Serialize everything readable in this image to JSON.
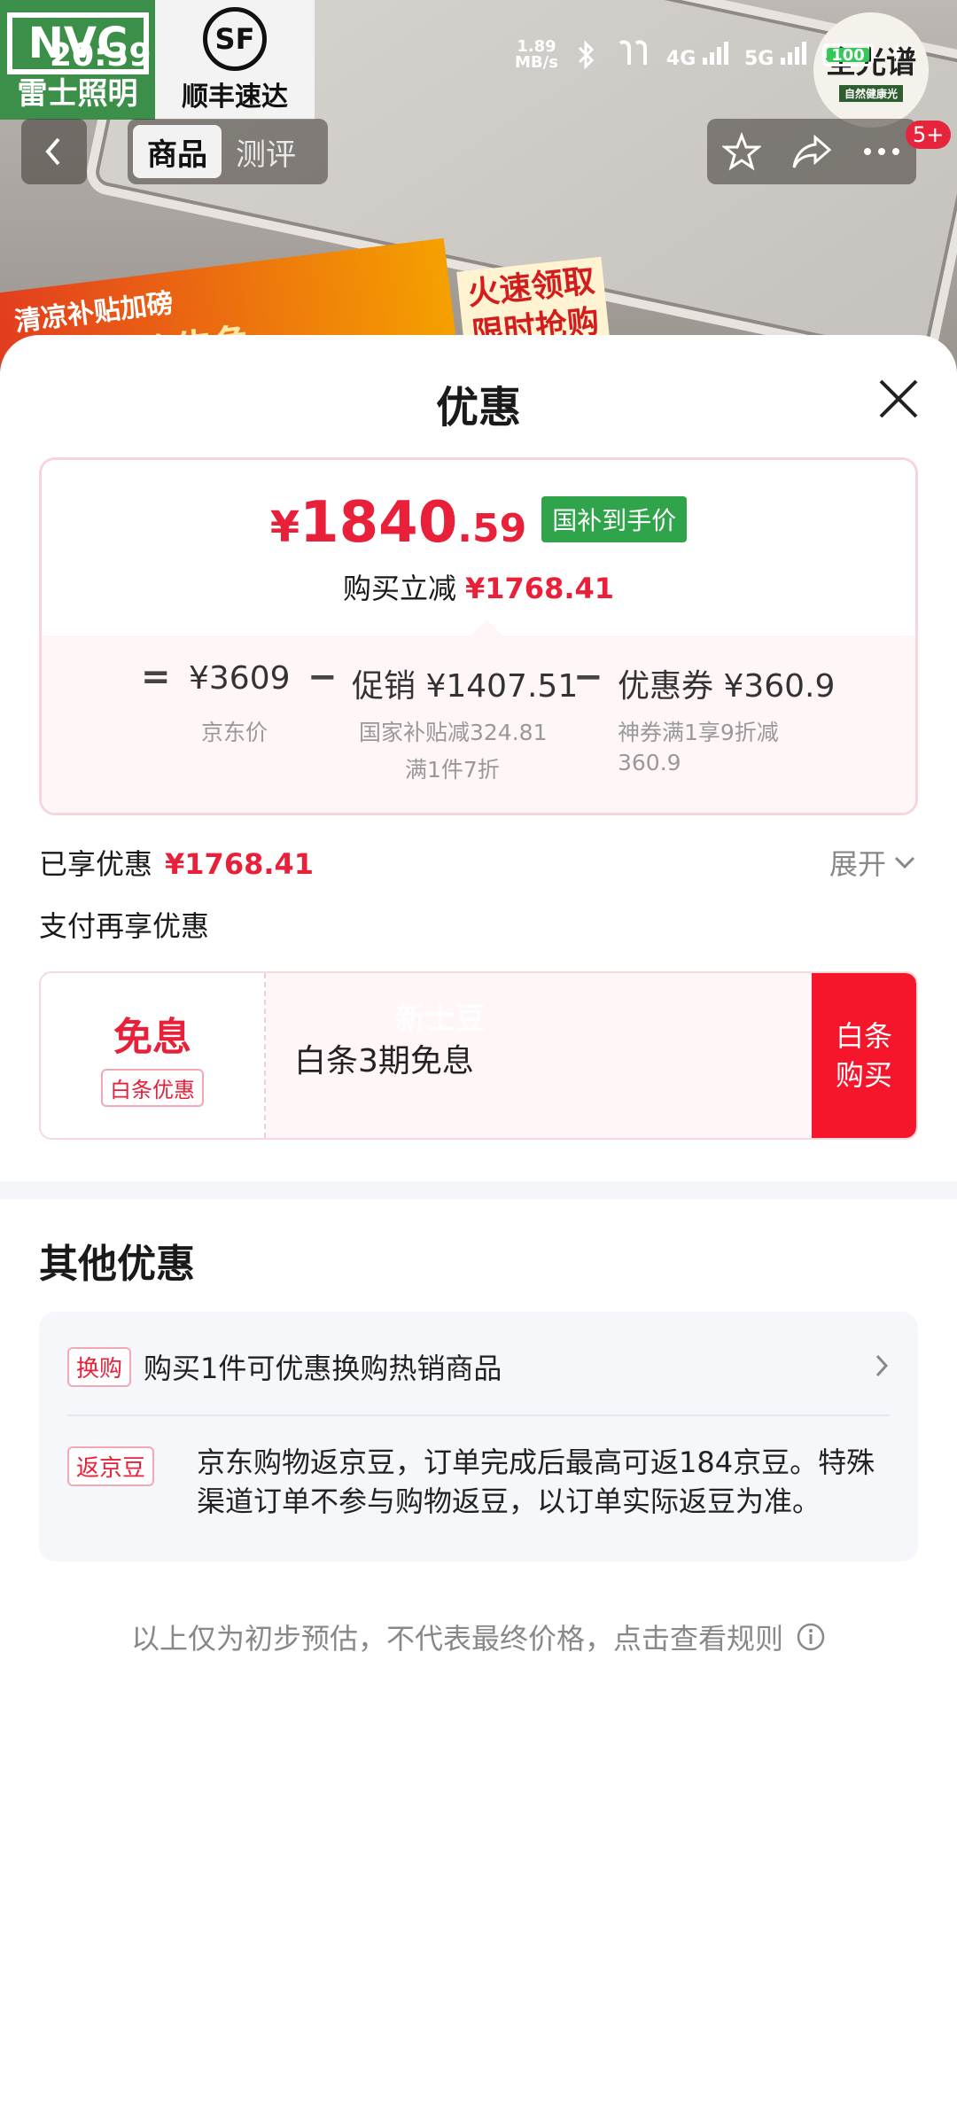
{
  "background": {
    "brand_logo": "NVC",
    "brand_name": "雷士照明",
    "sf_logo": "SF",
    "sf_name": "顺丰速达",
    "spectrum": "全光谱",
    "spectrum_small": "自然健康光",
    "promo_line1": "清凉补贴加磅",
    "promo_line2": "补贴资格告急",
    "promo_side1": "火速领取",
    "promo_side2": "限时抢购"
  },
  "status_bar": {
    "time": "20:39",
    "speed_value": "1.89",
    "speed_unit": "MB/s",
    "net1": "4G",
    "net2": "5G",
    "battery": "100"
  },
  "nav": {
    "tabs": [
      {
        "label": "商品"
      },
      {
        "label": "测评"
      }
    ],
    "badge": "5+"
  },
  "sheet": {
    "title": "优惠",
    "price": {
      "currency": "¥",
      "integer": "1840",
      "decimal": ".59",
      "tag": "国补到手价",
      "reduce_label": "购买立减",
      "reduce_amount": "¥1768.41"
    },
    "breakdown": {
      "eq": "=",
      "minus": "−",
      "jd_price": "¥3609",
      "jd_label": "京东价",
      "promo": "促销 ¥1407.51",
      "promo_sub1": "国家补贴减324.81",
      "promo_sub2": "满1件7折",
      "coupon": "优惠券 ¥360.9",
      "coupon_sub1": "神券满1享9折减",
      "coupon_sub2": "360.9"
    },
    "enjoyed_label": "已享优惠",
    "enjoyed_amount": "¥1768.41",
    "expand_label": "展开",
    "pay_more_label": "支付再享优惠",
    "credit": {
      "big": "免息",
      "tag": "白条优惠",
      "text": "白条3期免息",
      "watermark": "新士豆",
      "button_line1": "白条",
      "button_line2": "购买"
    },
    "other": {
      "title": "其他优惠",
      "items": [
        {
          "tag": "换购",
          "text": "购买1件可优惠换购热销商品"
        },
        {
          "tag": "返京豆",
          "text": "京东购物返京豆，订单完成后最高可返184京豆。特殊渠道订单不参与购物返豆，以订单实际返豆为准。"
        }
      ]
    },
    "footnote": "以上仅为初步预估，不代表最终价格，点击查看规则"
  },
  "colors": {
    "accent_red": "#e8203a",
    "button_red": "#f5162c",
    "tag_green": "#2fa44a"
  }
}
